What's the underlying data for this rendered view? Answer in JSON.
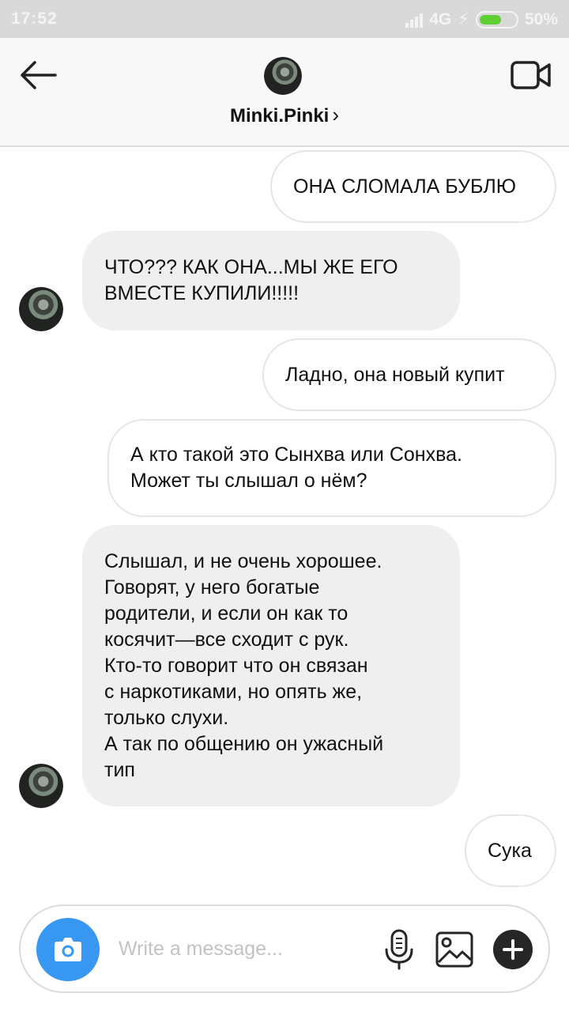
{
  "status": {
    "time": "17:52",
    "network": "4G",
    "battery": "50%"
  },
  "header": {
    "username": "Minki.Pinki",
    "chevron": "›",
    "back_icon": "arrow-left-icon",
    "video_icon": "video-camera-icon"
  },
  "messages": [
    {
      "side": "out",
      "text": "ОНА СЛОМАЛА БУБЛЮ"
    },
    {
      "side": "in",
      "text": "ЧТО??? КАК ОНА...МЫ ЖЕ ЕГО\nВМЕСТЕ КУПИЛИ!!!!!"
    },
    {
      "side": "out",
      "text": "Ладно, она новый купит"
    },
    {
      "side": "out",
      "text": "А кто такой это Сынхва или Сонхва.\nМожет ты слышал о нём?"
    },
    {
      "side": "in",
      "text": "Слышал, и не очень хорошее.\nГоворят, у него богатые\nродители, и если он как то\nкосячит—все сходит с рук.\nКто-то говорит что он связан\nс наркотиками, но опять же,\nтолько слухи.\nА так по общению он ужасный\nтип"
    },
    {
      "side": "out",
      "text": "Сука"
    }
  ],
  "composer": {
    "placeholder": "Write a message...",
    "camera_icon": "camera-icon",
    "mic_icon": "microphone-icon",
    "gallery_icon": "image-icon",
    "plus_icon": "plus-icon"
  },
  "colors": {
    "accent": "#3897f0",
    "incoming_bubble": "#efefef",
    "battery": "#5fcf33"
  }
}
